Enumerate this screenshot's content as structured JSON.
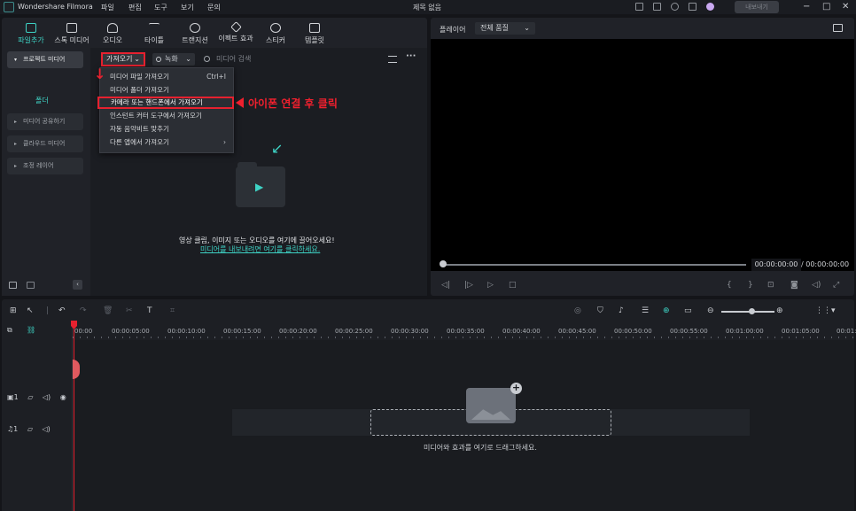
{
  "app": {
    "name": "Wondershare Filmora",
    "document_title": "제목 없음",
    "export_label": "내보내기",
    "menu": [
      "파일",
      "편집",
      "도구",
      "보기",
      "문의"
    ],
    "window_controls": [
      "−",
      "□",
      "✕"
    ]
  },
  "toolbar_tabs": [
    {
      "label": "파일추가",
      "icon": "media-import-icon"
    },
    {
      "label": "스톡 미디어",
      "icon": "stock-media-icon"
    },
    {
      "label": "오디오",
      "icon": "music-note-icon"
    },
    {
      "label": "타이틀",
      "icon": "text-t-icon"
    },
    {
      "label": "트랜지션",
      "icon": "transition-icon"
    },
    {
      "label": "이펙트 효과",
      "icon": "sparkle-icon"
    },
    {
      "label": "스티커",
      "icon": "sticker-icon"
    },
    {
      "label": "템플릿",
      "icon": "template-icon"
    }
  ],
  "sidebar": {
    "project_media": "프로젝트 미디어",
    "folder": "폴더",
    "shared_media": "미디어 공유하기",
    "cloud_media": "클라우드 미디어",
    "adjustment_layer": "조정 레이어"
  },
  "media": {
    "import_label": "가져오기",
    "record_label": "녹화",
    "search_placeholder": "미디어 검색",
    "drop_hint": "영상 클립, 이미지 또는 오디오를 여기에 끌어오세요!",
    "drop_link": "미디어를 내보내려면 여기를 클릭하세요."
  },
  "dropdown": {
    "items": [
      {
        "label": "미디어 파일 가져오기",
        "shortcut": "Ctrl+I"
      },
      {
        "label": "미디어 폴더 가져오기",
        "shortcut": ""
      },
      {
        "label": "카메라 또는 핸드폰에서 가져오기",
        "shortcut": ""
      },
      {
        "label": "인스턴트 커터 도구에서 가져오기",
        "shortcut": ""
      },
      {
        "label": "자동 음악비트 맞추기",
        "shortcut": ""
      },
      {
        "label": "다른 앱에서 가져오기",
        "shortcut": "›"
      }
    ]
  },
  "annotation": "아이폰 연결 후 클릭",
  "preview": {
    "player_label": "플레이어",
    "quality": "전체 품질",
    "current_time": "00:00:00:00",
    "total_time": "/ 00:00:00:00"
  },
  "timeline": {
    "ticks": [
      "00:00",
      "00:00:05:00",
      "00:00:10:00",
      "00:00:15:00",
      "00:00:20:00",
      "00:00:25:00",
      "00:00:30:00",
      "00:00:35:00",
      "00:00:40:00",
      "00:00:45:00",
      "00:00:50:00",
      "00:00:55:00",
      "00:01:00:00",
      "00:01:05:00",
      "00:01:"
    ],
    "video_track": "1",
    "audio_track": "1",
    "hint": "미디어와 효과를 여기로 드래그하세요."
  },
  "colors": {
    "accent": "#3ed3c5",
    "highlight_red": "#e6212f"
  }
}
